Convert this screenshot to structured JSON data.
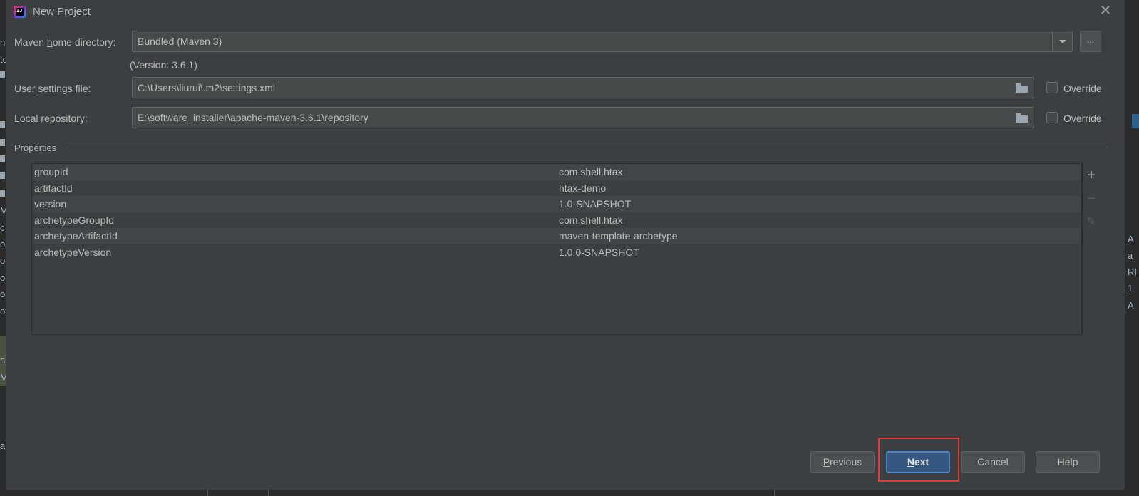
{
  "window": {
    "title": "New Project",
    "close_glyph": "✕"
  },
  "background_ide": {
    "left_fragments": [
      "n",
      "to",
      "M",
      "c",
      "ol",
      "ol",
      "ol",
      "ol",
      "ot",
      "n.",
      "M",
      "a"
    ],
    "right_fragments": [
      "A",
      "a",
      "RI",
      "1",
      "A"
    ]
  },
  "form": {
    "maven_home": {
      "label_pre": "Maven ",
      "label_mnemonic": "h",
      "label_post": "ome directory:",
      "value": "Bundled (Maven 3)",
      "browse_label": "...",
      "version_note": "(Version: 3.6.1)"
    },
    "user_settings": {
      "label_pre": "User ",
      "label_mnemonic": "s",
      "label_post": "ettings file:",
      "value": "C:\\Users\\liurui\\.m2\\settings.xml",
      "override_label": "Override",
      "override_checked": false
    },
    "local_repo": {
      "label_pre": "Local ",
      "label_mnemonic": "r",
      "label_post": "epository:",
      "value": "E:\\software_installer\\apache-maven-3.6.1\\repository",
      "override_label": "Override",
      "override_checked": false
    }
  },
  "properties": {
    "label": "Properties",
    "rows": [
      {
        "key": "groupId",
        "value": "com.shell.htax"
      },
      {
        "key": "artifactId",
        "value": "htax-demo"
      },
      {
        "key": "version",
        "value": "1.0-SNAPSHOT"
      },
      {
        "key": "archetypeGroupId",
        "value": "com.shell.htax"
      },
      {
        "key": "archetypeArtifactId",
        "value": "maven-template-archetype"
      },
      {
        "key": "archetypeVersion",
        "value": "1.0.0-SNAPSHOT"
      }
    ],
    "toolbar": {
      "add": "+",
      "remove": "−",
      "edit": "✎"
    }
  },
  "buttons": {
    "previous": {
      "mnemonic": "P",
      "rest": "revious"
    },
    "next": {
      "mnemonic": "N",
      "rest": "ext"
    },
    "cancel": "Cancel",
    "help": "Help"
  },
  "colors": {
    "dialog_bg": "#3c3f41",
    "field_bg": "#45494a",
    "primary_button": "#365880",
    "highlight_box": "#e53935"
  }
}
